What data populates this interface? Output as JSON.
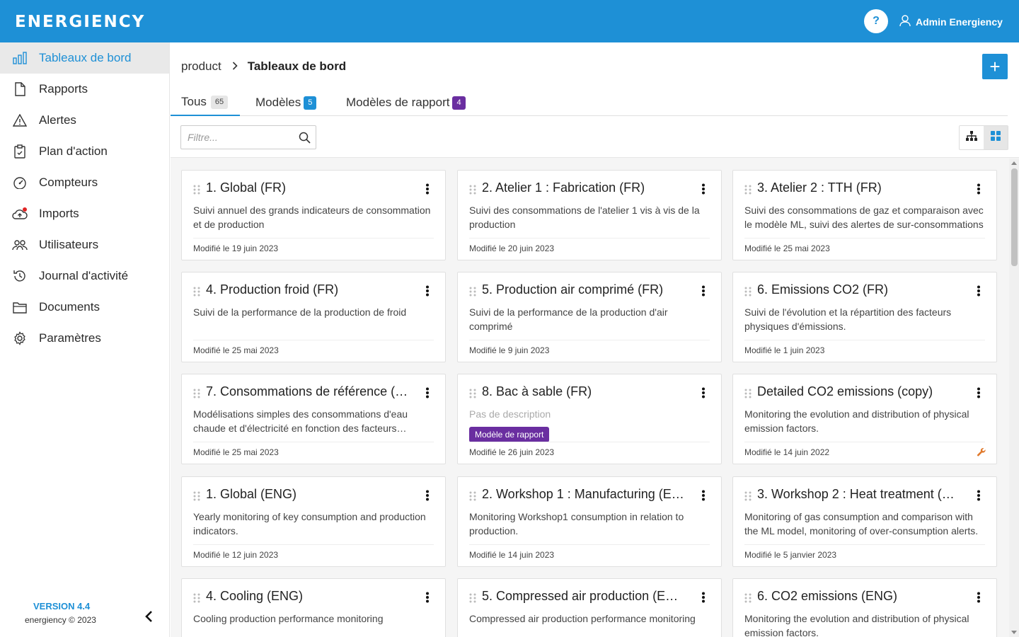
{
  "header": {
    "logo": "ENERGIENCY",
    "help_label": "?",
    "user_name": "Admin Energiency"
  },
  "sidebar": {
    "items": [
      {
        "label": "Tableaux de bord",
        "icon": "bar-chart-icon",
        "active": true
      },
      {
        "label": "Rapports",
        "icon": "file-icon"
      },
      {
        "label": "Alertes",
        "icon": "warning-icon"
      },
      {
        "label": "Plan d'action",
        "icon": "clipboard-icon"
      },
      {
        "label": "Compteurs",
        "icon": "gauge-icon"
      },
      {
        "label": "Imports",
        "icon": "cloud-upload-icon"
      },
      {
        "label": "Utilisateurs",
        "icon": "users-icon"
      },
      {
        "label": "Journal d'activité",
        "icon": "history-icon"
      },
      {
        "label": "Documents",
        "icon": "folder-icon"
      },
      {
        "label": "Paramètres",
        "icon": "gear-icon"
      }
    ],
    "version": "VERSION 4.4",
    "copyright": "energiency © 2023"
  },
  "breadcrumb": {
    "root": "product",
    "current": "Tableaux de bord"
  },
  "add_label": "+",
  "tabs": [
    {
      "label": "Tous",
      "count": "65"
    },
    {
      "label": "Modèles",
      "count": "5"
    },
    {
      "label": "Modèles de rapport",
      "count": "4"
    }
  ],
  "filter": {
    "placeholder": "Filtre..."
  },
  "cards": [
    {
      "title": "1. Global (FR)",
      "desc": "Suivi annuel des grands indicateurs de consommation et de production",
      "modified": "Modifié le 19 juin 2023"
    },
    {
      "title": "2. Atelier 1 : Fabrication (FR)",
      "desc": "Suivi des consommations de l'atelier 1 vis à vis de la production",
      "modified": "Modifié le 20 juin 2023"
    },
    {
      "title": "3. Atelier 2 : TTH (FR)",
      "desc": "Suivi des consommations de gaz et comparaison avec le modèle ML, suivi des alertes de sur-consommations",
      "modified": "Modifié le 25 mai 2023"
    },
    {
      "title": "4. Production froid (FR)",
      "desc": "Suivi de la performance de la production de froid",
      "modified": "Modifié le 25 mai 2023"
    },
    {
      "title": "5. Production air comprimé (FR)",
      "desc": "Suivi de la performance de la production d'air comprimé",
      "modified": "Modifié le 9 juin 2023"
    },
    {
      "title": "6. Emissions CO2 (FR)",
      "desc": "Suivi de l'évolution et la répartition des facteurs physiques d'émissions.",
      "modified": "Modifié le 1 juin 2023"
    },
    {
      "title": "7. Consommations de référence (…",
      "desc": "Modélisations simples des consommations d'eau chaude et d'électricité en fonction des facteurs…",
      "modified": "Modifié le 25 mai 2023"
    },
    {
      "title": "8. Bac à sable (FR)",
      "desc": "Pas de description",
      "badge": "Modèle de rapport",
      "modified": "Modifié le 26 juin 2023"
    },
    {
      "title": "Detailed CO2 emissions (copy)",
      "desc": "Monitoring the evolution and distribution of physical emission factors.",
      "modified": "Modifié le 14 juin 2022",
      "wrench": true
    },
    {
      "title": "1. Global (ENG)",
      "desc": "Yearly monitoring of key consumption and production indicators.",
      "modified": "Modifié le 12 juin 2023"
    },
    {
      "title": "2. Workshop 1 : Manufacturing (E…",
      "desc": "Monitoring Workshop1 consumption in relation to production.",
      "modified": "Modifié le 14 juin 2023"
    },
    {
      "title": "3. Workshop 2 : Heat treatment (E…",
      "desc": "Monitoring of gas consumption and comparison with the ML model, monitoring of over-consumption alerts.",
      "modified": "Modifié le 5 janvier 2023"
    },
    {
      "title": "4. Cooling (ENG)",
      "desc": "Cooling production performance monitoring",
      "modified": ""
    },
    {
      "title": "5. Compressed air production (EN…",
      "desc": "Compressed air production performance monitoring",
      "modified": ""
    },
    {
      "title": "6. CO2 emissions (ENG)",
      "desc": "Monitoring the evolution and distribution of physical emission factors.",
      "modified": ""
    }
  ]
}
